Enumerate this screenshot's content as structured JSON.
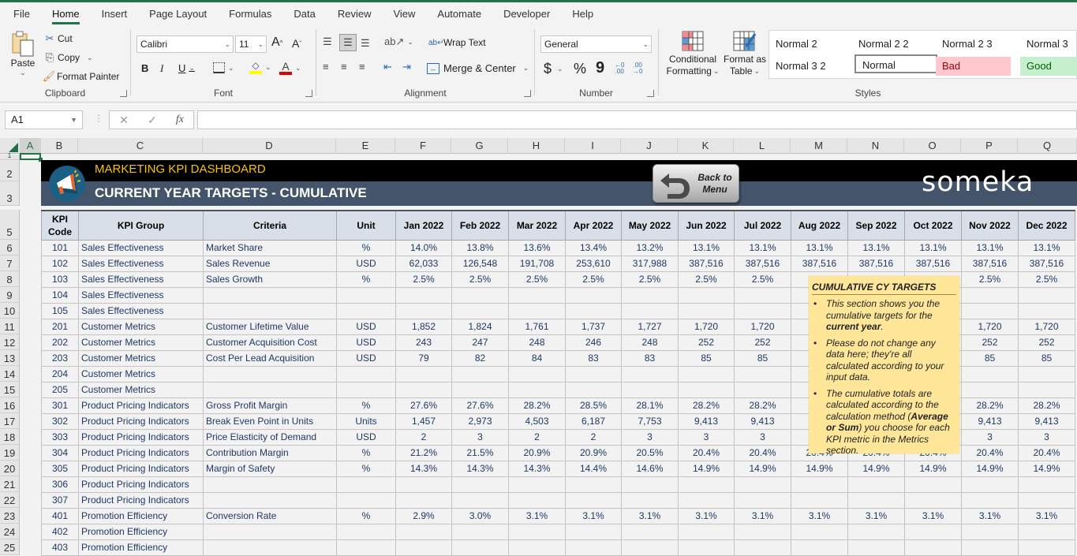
{
  "menu": {
    "tabs": [
      "File",
      "Home",
      "Insert",
      "Page Layout",
      "Formulas",
      "Data",
      "Review",
      "View",
      "Automate",
      "Developer",
      "Help"
    ],
    "active": "Home"
  },
  "ribbon": {
    "clipboard": {
      "label": "Clipboard",
      "paste": "Paste",
      "cut": "Cut",
      "copy": "Copy",
      "format_painter": "Format Painter"
    },
    "font": {
      "label": "Font",
      "font_name": "Calibri",
      "font_size": "11",
      "bold": "B",
      "italic": "I",
      "underline": "U",
      "grow": "A",
      "shrink": "A"
    },
    "alignment": {
      "label": "Alignment",
      "wrap_text": "Wrap Text",
      "merge_center": "Merge & Center"
    },
    "number": {
      "label": "Number",
      "format": "General",
      "currency": "$",
      "percent": "%",
      "comma": "9",
      "inc_decimal": ".00",
      "dec_decimal": ".00"
    },
    "styles": {
      "label": "Styles",
      "conditional_formatting_1": "Conditional",
      "conditional_formatting_2": "Formatting",
      "format_as_table_1": "Format as",
      "format_as_table_2": "Table",
      "cells": [
        {
          "name": "Normal 2",
          "style": "plain"
        },
        {
          "name": "Normal 2 2",
          "style": "plain"
        },
        {
          "name": "Normal 2 3",
          "style": "plain"
        },
        {
          "name": "Normal 3",
          "style": "plain"
        },
        {
          "name": "Normal 3 2",
          "style": "plain"
        },
        {
          "name": "Normal",
          "style": "selected"
        },
        {
          "name": "Bad",
          "style": "bad"
        },
        {
          "name": "Good",
          "style": "good"
        }
      ],
      "colors": {
        "bad_bg": "#ffc7ce",
        "bad_fg": "#9c0006",
        "good_bg": "#c6efce",
        "good_fg": "#006100"
      }
    }
  },
  "formula_bar": {
    "name_box": "A1",
    "fx": "fx",
    "formula": ""
  },
  "columns": [
    "A",
    "B",
    "C",
    "D",
    "E",
    "F",
    "G",
    "H",
    "I",
    "J",
    "K",
    "L",
    "M",
    "N",
    "O",
    "P",
    "Q"
  ],
  "row_numbers": [
    "1",
    "2",
    "3",
    "5",
    "6",
    "7",
    "8",
    "9",
    "10",
    "11",
    "12",
    "13",
    "14",
    "15",
    "16",
    "17",
    "18",
    "19",
    "20",
    "21",
    "22",
    "23",
    "24",
    "25"
  ],
  "dashboard": {
    "title": "MARKETING KPI DASHBOARD",
    "subtitle": "CURRENT YEAR TARGETS - CUMULATIVE",
    "back_button": "Back to Menu",
    "brand": "someka",
    "colors": {
      "title": "#f9c300",
      "banner_top": "#000000",
      "banner_bottom": "#44546a",
      "header_bg": "#d9dfe8",
      "text": "#1f3864",
      "note_bg": "#ffe699"
    }
  },
  "table": {
    "headers": [
      "KPI Code",
      "KPI Group",
      "Criteria",
      "Unit",
      "Jan 2022",
      "Feb 2022",
      "Mar 2022",
      "Apr 2022",
      "May 2022",
      "Jun 2022",
      "Jul 2022",
      "Aug 2022",
      "Sep 2022",
      "Oct 2022",
      "Nov 2022",
      "Dec 2022"
    ],
    "rows": [
      {
        "code": "101",
        "group": "Sales Effectiveness",
        "criteria": "Market Share",
        "unit": "%",
        "values": [
          "14.0%",
          "13.8%",
          "13.6%",
          "13.4%",
          "13.2%",
          "13.1%",
          "13.1%",
          "13.1%",
          "13.1%",
          "13.1%",
          "13.1%",
          "13.1%"
        ]
      },
      {
        "code": "102",
        "group": "Sales Effectiveness",
        "criteria": "Sales Revenue",
        "unit": "USD",
        "values": [
          "62,033",
          "126,548",
          "191,708",
          "253,610",
          "317,988",
          "387,516",
          "387,516",
          "387,516",
          "387,516",
          "387,516",
          "387,516",
          "387,516"
        ]
      },
      {
        "code": "103",
        "group": "Sales Effectiveness",
        "criteria": "Sales Growth",
        "unit": "%",
        "values": [
          "2.5%",
          "2.5%",
          "2.5%",
          "2.5%",
          "2.5%",
          "2.5%",
          "2.5%",
          "",
          "",
          "",
          "2.5%",
          "2.5%"
        ]
      },
      {
        "code": "104",
        "group": "Sales Effectiveness",
        "criteria": "",
        "unit": "",
        "values": [
          "",
          "",
          "",
          "",
          "",
          "",
          "",
          "",
          "",
          "",
          "",
          ""
        ]
      },
      {
        "code": "105",
        "group": "Sales Effectiveness",
        "criteria": "",
        "unit": "",
        "values": [
          "",
          "",
          "",
          "",
          "",
          "",
          "",
          "",
          "",
          "",
          "",
          ""
        ]
      },
      {
        "code": "201",
        "group": "Customer Metrics",
        "criteria": "Customer Lifetime Value",
        "unit": "USD",
        "values": [
          "1,852",
          "1,824",
          "1,761",
          "1,737",
          "1,727",
          "1,720",
          "1,720",
          "",
          "",
          "",
          "1,720",
          "1,720"
        ]
      },
      {
        "code": "202",
        "group": "Customer Metrics",
        "criteria": "Customer Acquisition Cost",
        "unit": "USD",
        "values": [
          "243",
          "247",
          "248",
          "246",
          "248",
          "252",
          "252",
          "",
          "",
          "",
          "252",
          "252"
        ]
      },
      {
        "code": "203",
        "group": "Customer Metrics",
        "criteria": "Cost Per Lead Acquisition",
        "unit": "USD",
        "values": [
          "79",
          "82",
          "84",
          "83",
          "83",
          "85",
          "85",
          "",
          "",
          "",
          "85",
          "85"
        ]
      },
      {
        "code": "204",
        "group": "Customer Metrics",
        "criteria": "",
        "unit": "",
        "values": [
          "",
          "",
          "",
          "",
          "",
          "",
          "",
          "",
          "",
          "",
          "",
          ""
        ]
      },
      {
        "code": "205",
        "group": "Customer Metrics",
        "criteria": "",
        "unit": "",
        "values": [
          "",
          "",
          "",
          "",
          "",
          "",
          "",
          "",
          "",
          "",
          "",
          ""
        ]
      },
      {
        "code": "301",
        "group": "Product Pricing Indicators",
        "criteria": "Gross Profit Margin",
        "unit": "%",
        "values": [
          "27.6%",
          "27.6%",
          "28.2%",
          "28.5%",
          "28.1%",
          "28.2%",
          "28.2%",
          "",
          "",
          "",
          "28.2%",
          "28.2%"
        ]
      },
      {
        "code": "302",
        "group": "Product Pricing Indicators",
        "criteria": "Break Even Point in Units",
        "unit": "Units",
        "values": [
          "1,457",
          "2,973",
          "4,503",
          "6,187",
          "7,753",
          "9,413",
          "9,413",
          "",
          "",
          "",
          "9,413",
          "9,413"
        ]
      },
      {
        "code": "303",
        "group": "Product Pricing Indicators",
        "criteria": "Price Elasticity of Demand",
        "unit": "USD",
        "values": [
          "2",
          "3",
          "2",
          "2",
          "3",
          "3",
          "3",
          "",
          "",
          "",
          "3",
          "3"
        ]
      },
      {
        "code": "304",
        "group": "Product Pricing Indicators",
        "criteria": "Contribution Margin",
        "unit": "%",
        "values": [
          "21.2%",
          "21.5%",
          "20.9%",
          "20.9%",
          "20.5%",
          "20.4%",
          "20.4%",
          "20.4%",
          "20.4%",
          "20.4%",
          "20.4%",
          "20.4%"
        ]
      },
      {
        "code": "305",
        "group": "Product Pricing Indicators",
        "criteria": "Margin of Safety",
        "unit": "%",
        "values": [
          "14.3%",
          "14.3%",
          "14.3%",
          "14.4%",
          "14.6%",
          "14.9%",
          "14.9%",
          "14.9%",
          "14.9%",
          "14.9%",
          "14.9%",
          "14.9%"
        ]
      },
      {
        "code": "306",
        "group": "Product Pricing Indicators",
        "criteria": "",
        "unit": "",
        "values": [
          "",
          "",
          "",
          "",
          "",
          "",
          "",
          "",
          "",
          "",
          "",
          ""
        ]
      },
      {
        "code": "307",
        "group": "Product Pricing Indicators",
        "criteria": "",
        "unit": "",
        "values": [
          "",
          "",
          "",
          "",
          "",
          "",
          "",
          "",
          "",
          "",
          "",
          ""
        ]
      },
      {
        "code": "401",
        "group": "Promotion Efficiency",
        "criteria": "Conversion Rate",
        "unit": "%",
        "values": [
          "2.9%",
          "3.0%",
          "3.1%",
          "3.1%",
          "3.1%",
          "3.1%",
          "3.1%",
          "3.1%",
          "3.1%",
          "3.1%",
          "3.1%",
          "3.1%"
        ]
      },
      {
        "code": "402",
        "group": "Promotion Efficiency",
        "criteria": "",
        "unit": "",
        "values": [
          "",
          "",
          "",
          "",
          "",
          "",
          "",
          "",
          "",
          "",
          "",
          ""
        ]
      },
      {
        "code": "403",
        "group": "Promotion Efficiency",
        "criteria": "",
        "unit": "",
        "values": [
          "",
          "",
          "",
          "",
          "",
          "",
          "",
          "",
          "",
          "",
          "",
          ""
        ]
      }
    ]
  },
  "note": {
    "title": "CUMULATIVE CY TARGETS",
    "b1_pre": "This section shows you the cumulative targets for the ",
    "b1_bold": "current year",
    "b1_post": ".",
    "b2": "Please do not change any data here; they're all calculated according to your input data.",
    "b3_pre": "The cumulative totals are calculated according to the calculation method (",
    "b3_bold": "Average or Sum",
    "b3_post": ") you choose for each KPI metric in the Metrics section."
  }
}
